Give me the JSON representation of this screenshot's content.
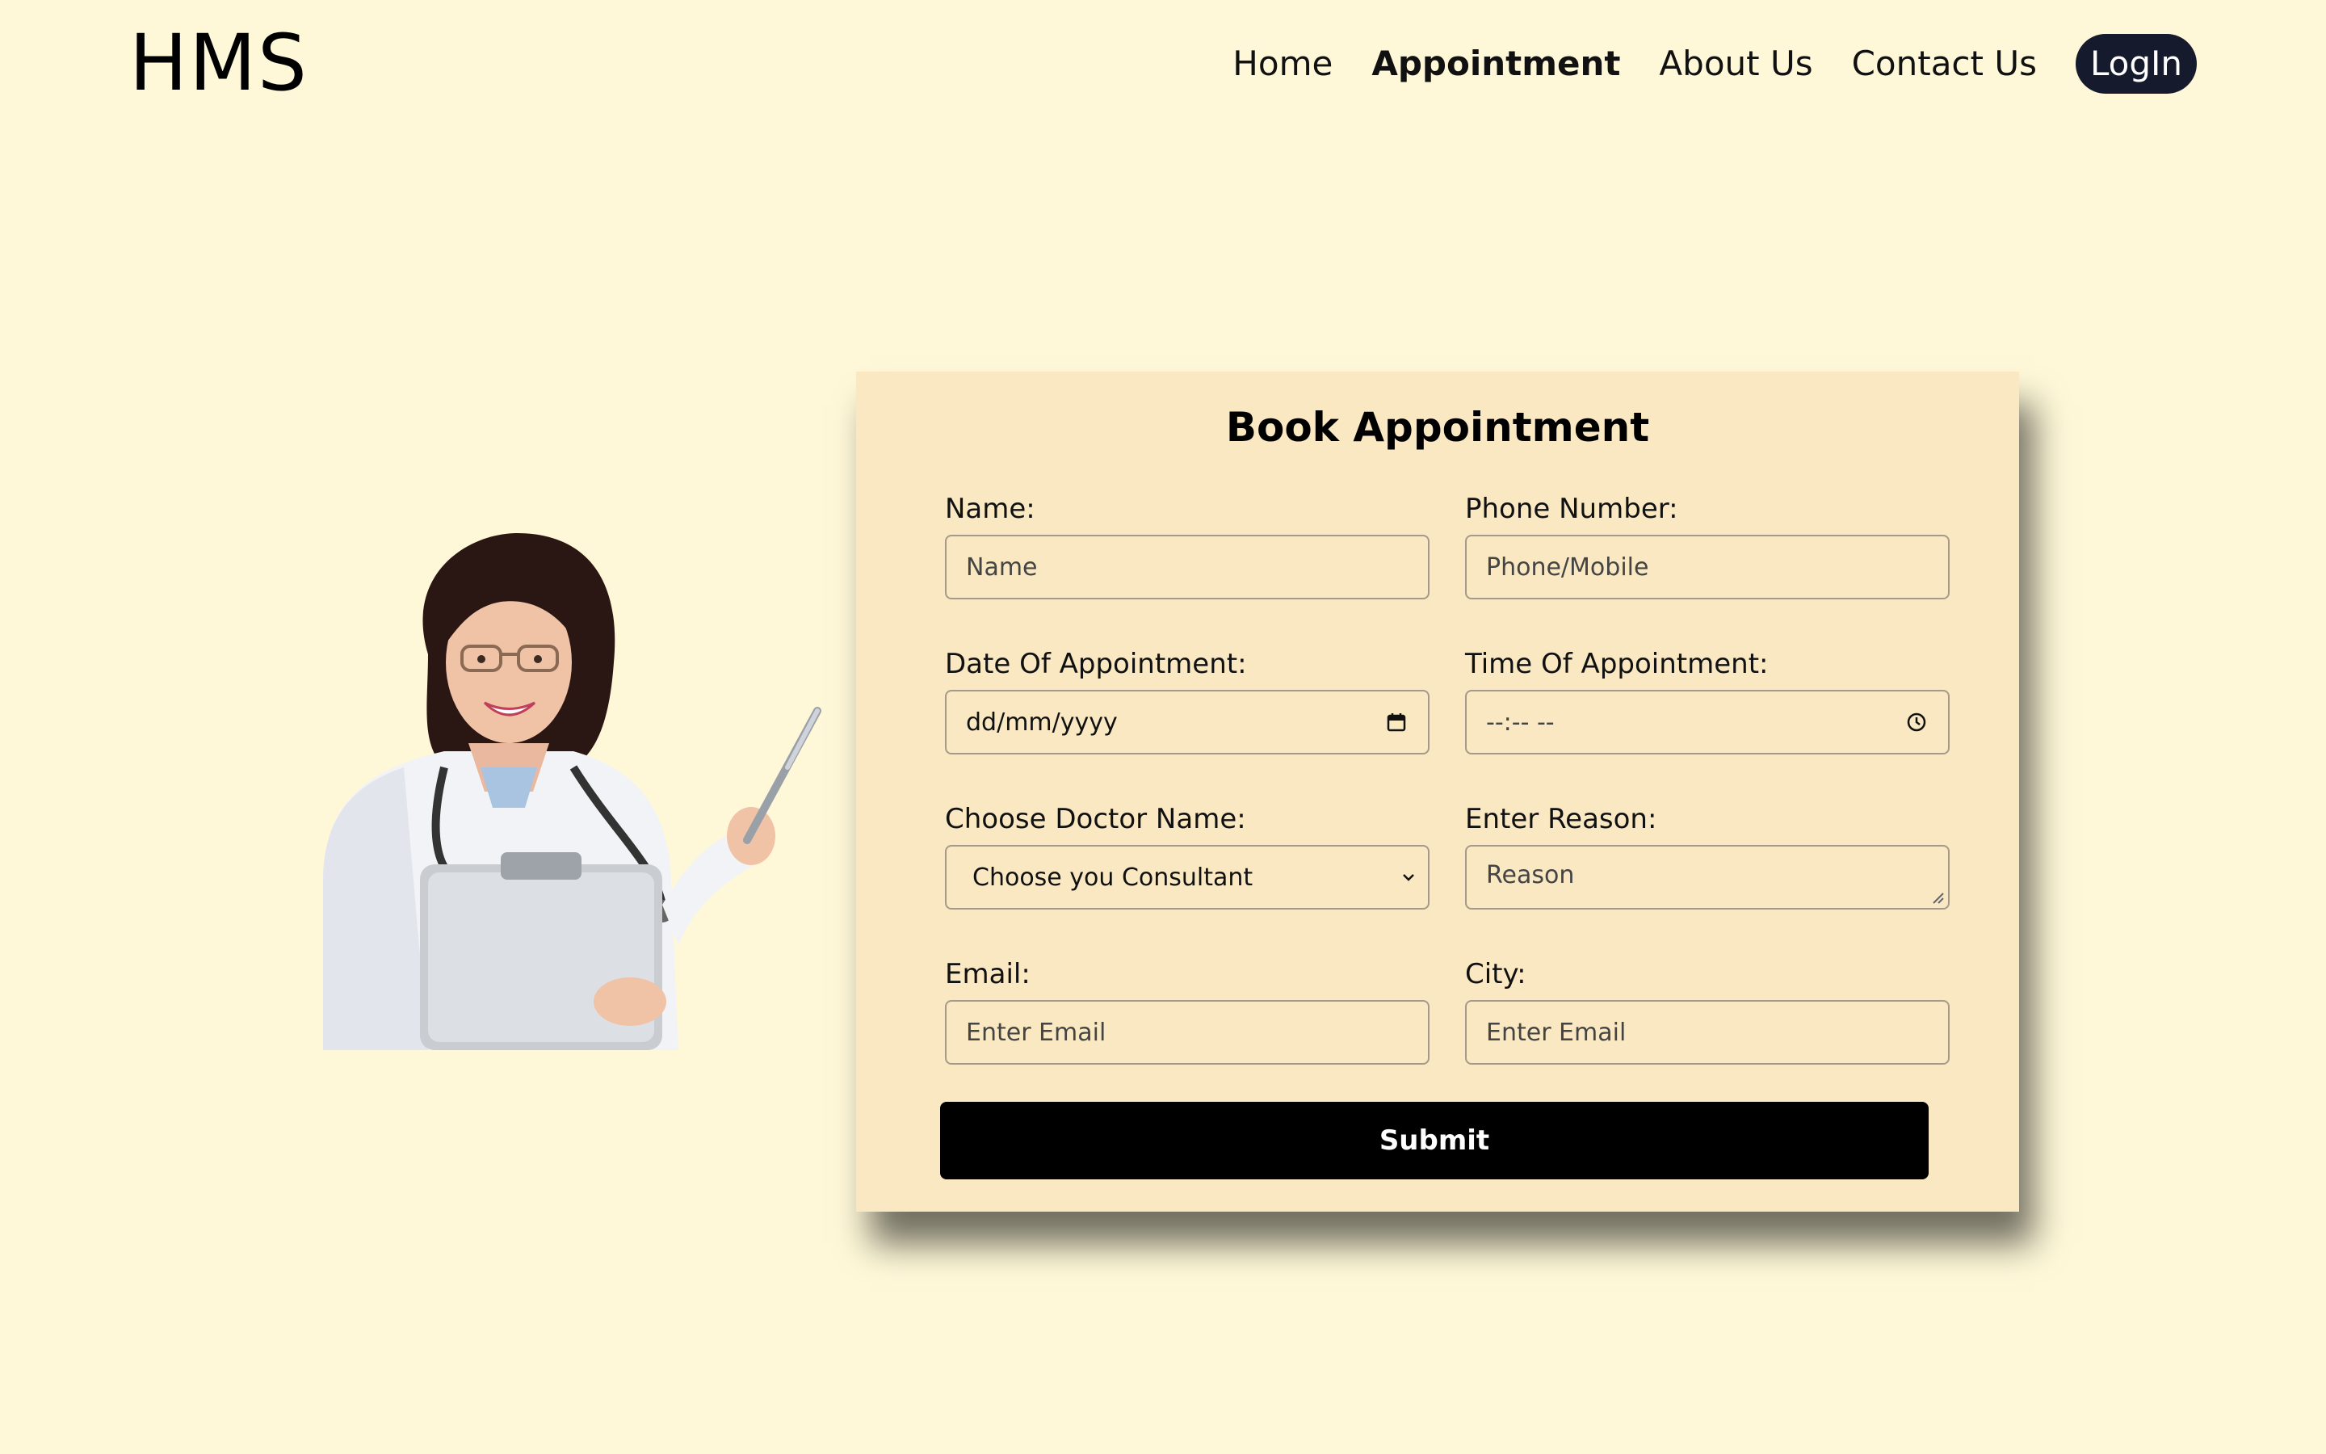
{
  "header": {
    "logo": "HMS",
    "nav": [
      {
        "label": "Home"
      },
      {
        "label": "Appointment"
      },
      {
        "label": "About Us"
      },
      {
        "label": "Contact Us"
      },
      {
        "label": "LogIn"
      }
    ]
  },
  "form": {
    "title": "Book Appointment",
    "name": {
      "label": "Name:",
      "placeholder": "Name"
    },
    "phone": {
      "label": "Phone Number:",
      "placeholder": "Phone/Mobile"
    },
    "date": {
      "label": "Date Of Appointment:",
      "value": "dd/mm/yyyy"
    },
    "time": {
      "label": "Time Of Appointment:",
      "value": "--:-- --"
    },
    "doctor": {
      "label": "Choose Doctor Name:",
      "selected": "Choose you Consultant"
    },
    "reason": {
      "label": "Enter Reason:",
      "placeholder": "Reason"
    },
    "email": {
      "label": "Email:",
      "placeholder": "Enter Email"
    },
    "city": {
      "label": "City:",
      "placeholder": "Enter Email"
    },
    "submit_label": "Submit"
  },
  "icons": {
    "date": "calendar-icon",
    "time": "clock-icon",
    "select": "chevron-down-icon"
  },
  "colors": {
    "background": "#fef8d8",
    "card": "#f9e8c1",
    "login_button": "#151a2c",
    "submit_button": "#000000"
  }
}
